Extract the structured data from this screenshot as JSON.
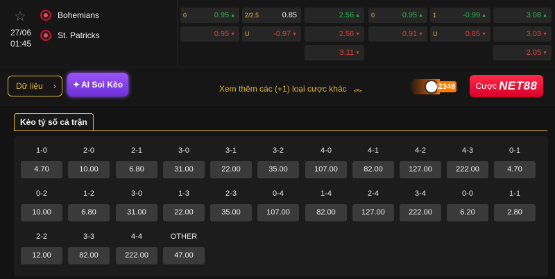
{
  "match": {
    "date": "27/06",
    "time": "01:45",
    "home": "Bohemians",
    "away": "St. Patricks",
    "cells": [
      {
        "hcp": "0",
        "odd": "0.95",
        "dir": "up"
      },
      {
        "hcp": "2/2.5",
        "odd": "0.85",
        "dir": "neu"
      },
      {
        "hcp": "",
        "odd": "2.56",
        "dir": "up"
      },
      {
        "hcp": "0",
        "odd": "0.95",
        "dir": "up"
      },
      {
        "hcp": "1",
        "odd": "-0.99",
        "dir": "up"
      },
      {
        "hcp": "",
        "odd": "3.08",
        "dir": "up"
      },
      {
        "hcp": "",
        "odd": "0.95",
        "dir": "down"
      },
      {
        "hcp": "U",
        "odd": "-0.97",
        "dir": "down"
      },
      {
        "hcp": "",
        "odd": "2.56",
        "dir": "down"
      },
      {
        "hcp": "",
        "odd": "0.91",
        "dir": "down"
      },
      {
        "hcp": "U",
        "odd": "0.85",
        "dir": "down"
      },
      {
        "hcp": "",
        "odd": "3.03",
        "dir": "down"
      },
      {
        "hcp": "",
        "odd": "3.11",
        "dir": "down"
      },
      {
        "hcp": "",
        "odd": "2.05",
        "dir": "down"
      }
    ]
  },
  "actions": {
    "data_label": "Dữ liệu",
    "ai_label": "AI Soi Kèo",
    "more_label": "Xem thêm các (+1) loại cược khác",
    "promo_number": "2348",
    "bet_label": "Cược",
    "brand": "NET88"
  },
  "colors": {
    "accent": "#e2b537",
    "up": "#2bb24c",
    "down": "#e23b3b",
    "brand": "#ff1f44",
    "ai": "#8a44f0"
  },
  "correct_score": {
    "tab_label": "Kèo tỷ số cả trận",
    "scores": [
      {
        "score": "1-0",
        "odd": "4.70"
      },
      {
        "score": "2-0",
        "odd": "10.00"
      },
      {
        "score": "2-1",
        "odd": "6.80"
      },
      {
        "score": "3-0",
        "odd": "31.00"
      },
      {
        "score": "3-1",
        "odd": "22.00"
      },
      {
        "score": "3-2",
        "odd": "35.00"
      },
      {
        "score": "4-0",
        "odd": "107.00"
      },
      {
        "score": "4-1",
        "odd": "82.00"
      },
      {
        "score": "4-2",
        "odd": "127.00"
      },
      {
        "score": "4-3",
        "odd": "222.00"
      },
      {
        "score": "0-1",
        "odd": "4.70"
      },
      {
        "score": "0-2",
        "odd": "10.00"
      },
      {
        "score": "1-2",
        "odd": "6.80"
      },
      {
        "score": "3-0",
        "odd": "31.00"
      },
      {
        "score": "1-3",
        "odd": "22.00"
      },
      {
        "score": "2-3",
        "odd": "35.00"
      },
      {
        "score": "0-4",
        "odd": "107.00"
      },
      {
        "score": "1-4",
        "odd": "82.00"
      },
      {
        "score": "2-4",
        "odd": "127.00"
      },
      {
        "score": "3-4",
        "odd": "222.00"
      },
      {
        "score": "0-0",
        "odd": "6.20"
      },
      {
        "score": "1-1",
        "odd": "2.80"
      },
      {
        "score": "2-2",
        "odd": "12.00"
      },
      {
        "score": "3-3",
        "odd": "82.00"
      },
      {
        "score": "4-4",
        "odd": "222.00"
      },
      {
        "score": "OTHER",
        "odd": "47.00"
      }
    ]
  }
}
